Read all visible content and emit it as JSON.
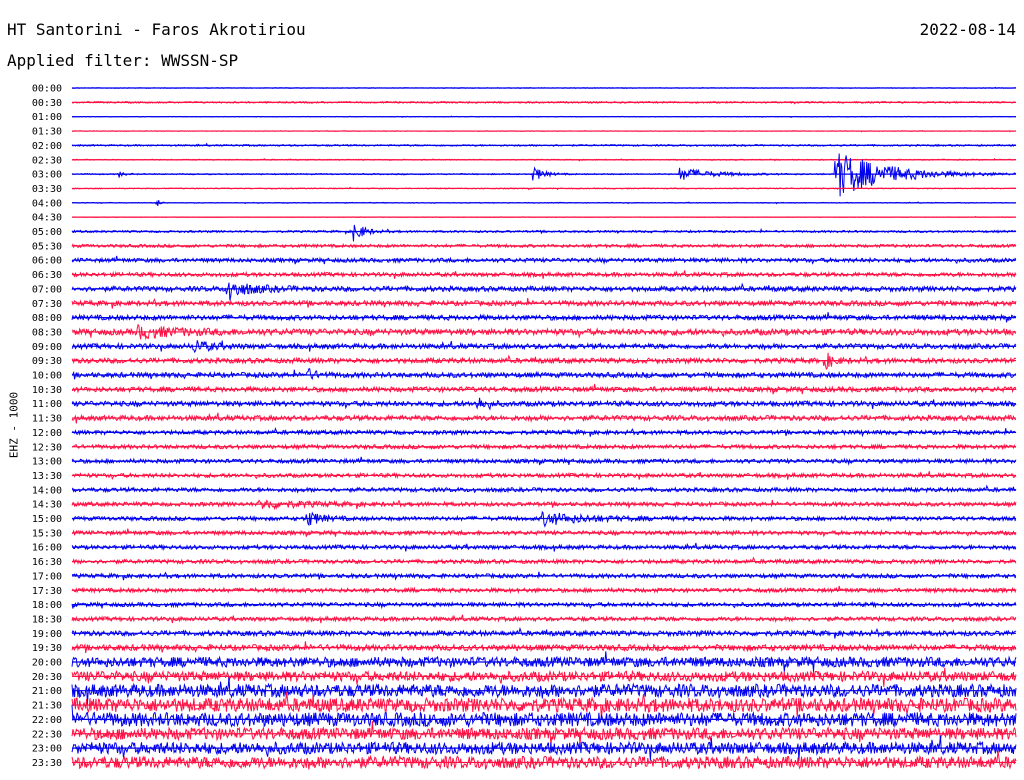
{
  "header": {
    "station": "HT Santorini - Faros Akrotiriou",
    "date": "2022-08-14",
    "filter": "Applied filter: WWSSN-SP"
  },
  "chart_data": {
    "type": "line",
    "title": "HT Santorini - Faros Akrotiriou",
    "subtitle": "Applied filter: WWSSN-SP",
    "ylabel": "EHZ - 1000",
    "colors": [
      "#0000ee",
      "#ff1144"
    ],
    "row_labels": [
      "00:00",
      "00:30",
      "01:00",
      "01:30",
      "02:00",
      "02:30",
      "03:00",
      "03:30",
      "04:00",
      "04:30",
      "05:00",
      "05:30",
      "06:00",
      "06:30",
      "07:00",
      "07:30",
      "08:00",
      "08:30",
      "09:00",
      "09:30",
      "10:00",
      "10:30",
      "11:00",
      "11:30",
      "12:00",
      "12:30",
      "13:00",
      "13:30",
      "14:00",
      "14:30",
      "15:00",
      "15:30",
      "16:00",
      "16:30",
      "17:00",
      "17:30",
      "18:00",
      "18:30",
      "19:00",
      "19:30",
      "20:00",
      "20:30",
      "21:00",
      "21:30",
      "22:00",
      "22:30",
      "23:00",
      "23:30"
    ],
    "noise_level": [
      0.3,
      0.8,
      0.3,
      0.3,
      0.8,
      0.5,
      0.6,
      0.5,
      0.4,
      0.3,
      1.0,
      1.5,
      2.0,
      2.0,
      2.5,
      2.5,
      2.5,
      3.0,
      2.5,
      2.5,
      2.5,
      2.5,
      2.5,
      2.5,
      2.0,
      2.0,
      2.0,
      2.0,
      2.0,
      2.0,
      2.0,
      2.0,
      2.0,
      2.0,
      2.0,
      2.0,
      2.0,
      2.0,
      2.5,
      3.0,
      5.0,
      5.0,
      6.5,
      7.0,
      7.0,
      6.0,
      6.0,
      6.0
    ],
    "events": [
      {
        "row": 6,
        "t": 0.051,
        "amp": 3,
        "dur": 0.005
      },
      {
        "row": 6,
        "t": 0.49,
        "amp": 7,
        "dur": 0.012
      },
      {
        "row": 6,
        "t": 0.645,
        "amp": 6,
        "dur": 0.04
      },
      {
        "row": 6,
        "t": 0.81,
        "amp": 24,
        "dur": 0.06
      },
      {
        "row": 8,
        "t": 0.09,
        "amp": 4,
        "dur": 0.004
      },
      {
        "row": 10,
        "t": 0.3,
        "amp": 9,
        "dur": 0.012
      },
      {
        "row": 14,
        "t": 0.165,
        "amp": 8,
        "dur": 0.03
      },
      {
        "row": 17,
        "t": 0.07,
        "amp": 5,
        "dur": 0.05
      },
      {
        "row": 18,
        "t": 0.13,
        "amp": 5,
        "dur": 0.02
      },
      {
        "row": 19,
        "t": 0.8,
        "amp": 6,
        "dur": 0.01
      },
      {
        "row": 20,
        "t": 0.25,
        "amp": 5,
        "dur": 0.01
      },
      {
        "row": 22,
        "t": 0.43,
        "amp": 6,
        "dur": 0.01
      },
      {
        "row": 29,
        "t": 0.2,
        "amp": 4,
        "dur": 0.05
      },
      {
        "row": 30,
        "t": 0.25,
        "amp": 7,
        "dur": 0.015
      },
      {
        "row": 30,
        "t": 0.5,
        "amp": 6,
        "dur": 0.05
      }
    ]
  }
}
